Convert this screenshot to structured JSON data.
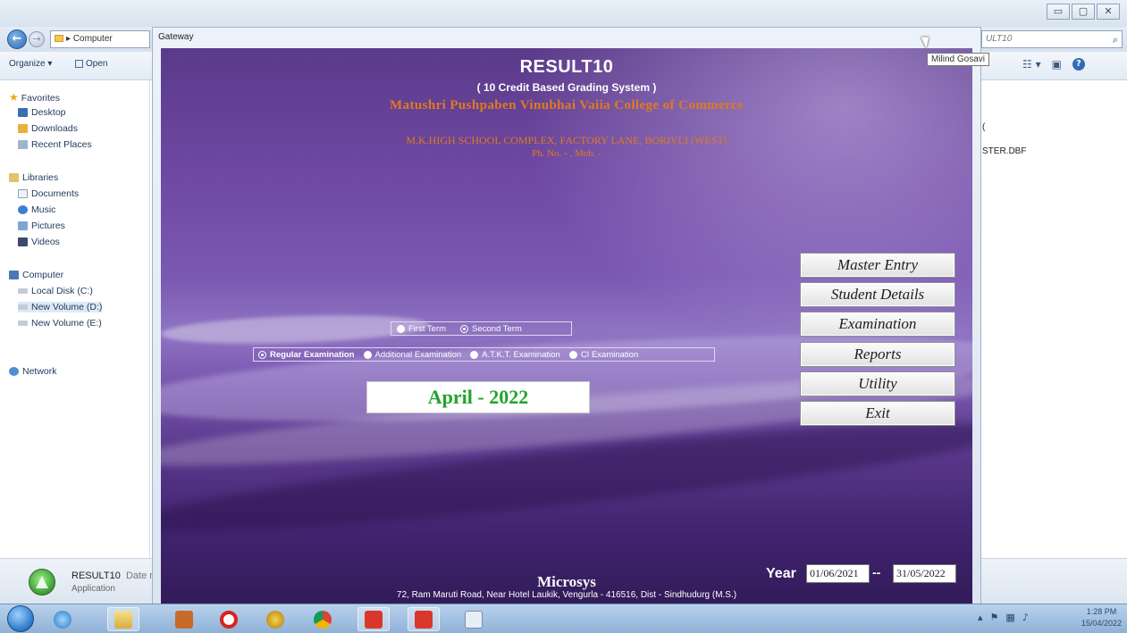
{
  "explorer": {
    "address": "Computer",
    "search_placeholder": "ULT10",
    "toolbar": {
      "organize": "Organize ▾",
      "open": "Open"
    },
    "nav": {
      "favorites": "Favorites",
      "desktop": "Desktop",
      "downloads": "Downloads",
      "recent": "Recent Places",
      "libraries": "Libraries",
      "documents": "Documents",
      "music": "Music",
      "pictures": "Pictures",
      "videos": "Videos",
      "computer": "Computer",
      "disk_c": "Local Disk (C:)",
      "disk_d": "New Volume (D:)",
      "disk_e": "New Volume (E:)",
      "network": "Network"
    },
    "file_fragment_1": "(",
    "file_fragment_2": "STER.DBF",
    "details": {
      "name": "RESULT10",
      "date_label": "Date r",
      "type": "Application"
    }
  },
  "app": {
    "window_title": "Gateway",
    "tooltip": "Milind Gosavi",
    "title": "RESULT10",
    "subtitle": "( 10 Credit Based Grading System )",
    "college": "Matushri Pushpaben Vinubhai Vaiia College of Commerce",
    "address": "M.K.HIGH SCHOOL COMPLEX, FACTORY LANE, BORIVLI (WEST)",
    "phone": "Ph. No. - , Mob. -",
    "terms": [
      {
        "label": "First Term",
        "state": "filled"
      },
      {
        "label": "Second Term",
        "state": "selected"
      }
    ],
    "exams": [
      {
        "label": "Regular Examination",
        "state": "selected"
      },
      {
        "label": "Additional Examination",
        "state": "filled"
      },
      {
        "label": "A.T.K.T. Examination",
        "state": "filled"
      },
      {
        "label": "CI Examination",
        "state": "filled"
      }
    ],
    "session": "April - 2022",
    "menu": [
      "Master Entry",
      "Student Details",
      "Examination",
      "Reports",
      "Utility",
      "Exit"
    ],
    "year_label": "Year",
    "year_from": "01/06/2021",
    "year_sep": "--",
    "year_to": "31/05/2022",
    "footer_name": "Microsys",
    "footer_address": "72, Ram Maruti Road, Near Hotel Laukik, Vengurla - 416516, Dist - Sindhudurg (M.S.)"
  },
  "taskbar": {
    "time": "1:28 PM",
    "date": "15/04/2022"
  },
  "colors": {
    "accent_orange": "#e07a1e",
    "session_green": "#22a32a",
    "purple_bg": "#6e48a2"
  }
}
